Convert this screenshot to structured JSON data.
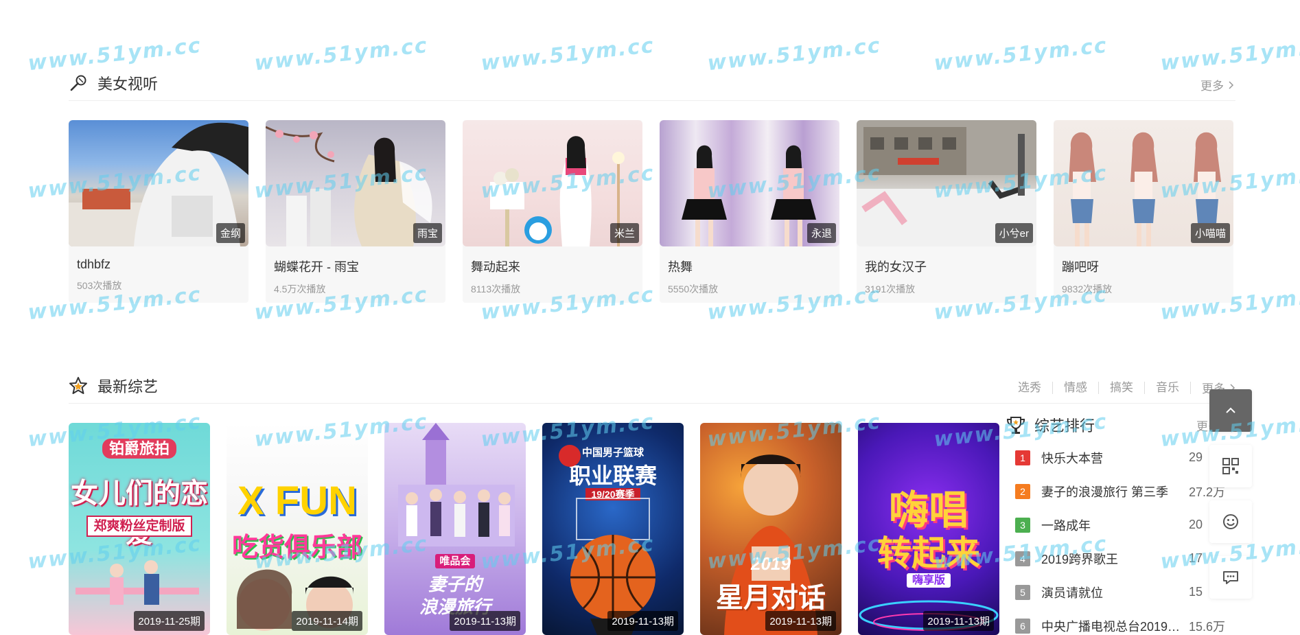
{
  "section1": {
    "title": "美女视听",
    "more": "更多",
    "cards": [
      {
        "title": "tdhbfz",
        "plays": "503次播放",
        "tag": "金纲"
      },
      {
        "title": "蝴蝶花开 - 雨宝",
        "plays": "4.5万次播放",
        "tag": "雨宝"
      },
      {
        "title": "舞动起来",
        "plays": "8113次播放",
        "tag": "米兰"
      },
      {
        "title": "热舞",
        "plays": "5550次播放",
        "tag": "永退"
      },
      {
        "title": "我的女汉子",
        "plays": "3191次播放",
        "tag": "小兮er"
      },
      {
        "title": "蹦吧呀",
        "plays": "9832次播放",
        "tag": "小喵喵"
      }
    ]
  },
  "section2": {
    "title": "最新综艺",
    "tabs": [
      "选秀",
      "情感",
      "搞笑",
      "音乐"
    ],
    "more": "更多",
    "posters": [
      {
        "tag": "2019-11-25期",
        "line1": "铂爵旅拍",
        "line2": "女儿们的恋爱",
        "line3": "郑爽粉丝定制版"
      },
      {
        "tag": "2019-11-14期",
        "line1": "",
        "line2": "X FUN",
        "line3": "吃货俱乐部"
      },
      {
        "tag": "2019-11-13期",
        "line1": "唯品会",
        "line2": "妻子的",
        "line3": "浪漫旅行"
      },
      {
        "tag": "2019-11-13期",
        "line1": "中国男子篮球",
        "line2": "职业联赛",
        "line3": "19/20赛季"
      },
      {
        "tag": "2019-11-13期",
        "line1": "2019",
        "line2": "星月对话",
        "line3": ""
      },
      {
        "tag": "2019-11-13期",
        "line1": "嗨唱",
        "line2": "转起来",
        "line3": "嗨享版"
      }
    ]
  },
  "ranking": {
    "title": "综艺排行",
    "more": "更多",
    "items": [
      {
        "rank": "1",
        "name": "快乐大本营",
        "value": "29",
        "color": "#e53935"
      },
      {
        "rank": "2",
        "name": "妻子的浪漫旅行 第三季",
        "value": "27.2万",
        "color": "#f57c20"
      },
      {
        "rank": "3",
        "name": "一路成年",
        "value": "20",
        "color": "#4caf50"
      },
      {
        "rank": "4",
        "name": "2019跨界歌王",
        "value": "17",
        "color": "#999999"
      },
      {
        "rank": "5",
        "name": "演员请就位",
        "value": "15",
        "color": "#999999"
      },
      {
        "rank": "6",
        "name": "中央广播电视总台2019主...",
        "value": "15.6万",
        "color": "#999999"
      }
    ]
  },
  "tools": {
    "icons": [
      "arrow-up-icon",
      "qrcode-icon",
      "smile-icon",
      "comment-icon"
    ]
  },
  "watermark": {
    "text": "www.51ym.cc"
  }
}
